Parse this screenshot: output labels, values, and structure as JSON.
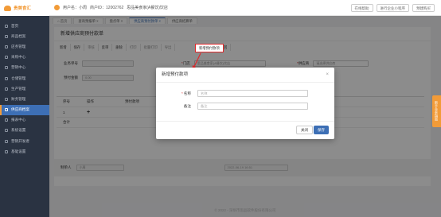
{
  "app": {
    "logo_text": "贵美食汇"
  },
  "topbar": {
    "user": "用户名：小周",
    "account": "商户ID：12002762",
    "store": "思品美食家(A餐饮)饮店",
    "buttons": [
      "在线帮助",
      "进行企业小程序",
      "预建购买"
    ]
  },
  "sidebar": {
    "items": [
      {
        "label": "首页",
        "active": false
      },
      {
        "label": "商品档案",
        "active": false
      },
      {
        "label": "店务管理",
        "active": false
      },
      {
        "label": "采购中心",
        "active": false
      },
      {
        "label": "营销中心",
        "active": false
      },
      {
        "label": "仓储管理",
        "active": false
      },
      {
        "label": "生产管理",
        "active": false
      },
      {
        "label": "财务管理",
        "active": false
      },
      {
        "label": "供应商档案",
        "active": true
      },
      {
        "label": "报表中心",
        "active": false
      },
      {
        "label": "系统设置",
        "active": false
      },
      {
        "label": "营销开发者",
        "active": false
      },
      {
        "label": "基础设置",
        "active": false
      }
    ]
  },
  "tabs": [
    {
      "label": "首页",
      "active": false
    },
    {
      "label": "查询预报单",
      "active": false
    },
    {
      "label": "盘点单",
      "active": false
    },
    {
      "label": "供应商预付款单",
      "active": true
    },
    {
      "label": "供应商结算单",
      "active": false
    }
  ],
  "page": {
    "title": "新增供应商预付款单",
    "toolbar": [
      {
        "label": "新增",
        "dim": false
      },
      {
        "label": "保存",
        "dim": false
      },
      {
        "label": "审核",
        "dim": true
      },
      {
        "label": "反审",
        "dim": false
      },
      {
        "label": "删除",
        "dim": false
      },
      {
        "label": "打印",
        "dim": true
      },
      {
        "label": "批量打印",
        "dim": true
      },
      {
        "label": "导出",
        "dim": true
      },
      {
        "label": "新增预付款项",
        "dim": false,
        "highlight": true
      },
      {
        "label": "设置",
        "dim": false
      },
      {
        "label": "返回",
        "dim": false
      }
    ],
    "form": {
      "order_no_label": "业务单号",
      "store_label": "门店",
      "store_value": "思品美食家(A餐饮)饮店",
      "supplier_label": "供应商",
      "supplier_value": "请选择供应商",
      "amount_label": "预付金额",
      "amount_value": "0.00"
    },
    "grid": {
      "headers": [
        "序号",
        "操作",
        "预付款项"
      ],
      "rows": [
        {
          "index": "1",
          "op": "+"
        }
      ],
      "total_label": "合计"
    },
    "footer": {
      "creator_label": "制单人",
      "creator_value": "小周",
      "date_value": "2022-06-19 16:51"
    }
  },
  "dialog": {
    "title": "新增预付款项",
    "name_label": "名称",
    "name_placeholder": "名称",
    "remark_label": "备注",
    "remark_placeholder": "备注",
    "close_label": "关闭",
    "save_label": "保存"
  },
  "float_tag": "新手业务指南",
  "copyright": "© 2022 - 深圳市思品软件股份有限公司"
}
